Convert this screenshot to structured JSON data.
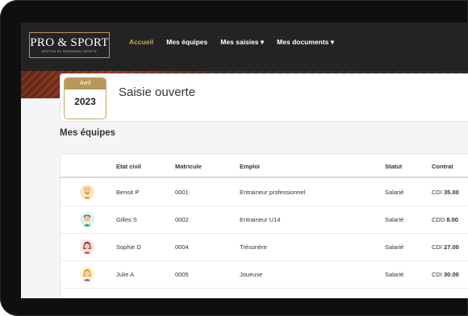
{
  "nav": {
    "logo_text": "PRO & SPORT",
    "logo_tagline": "GESTION DU PERSONNEL SPORTIF",
    "links": [
      {
        "label": "Accueil",
        "active": true
      },
      {
        "label": "Mes équipes",
        "active": false
      },
      {
        "label": "Mes saisies ▾",
        "active": false
      },
      {
        "label": "Mes documents ▾",
        "active": false
      }
    ]
  },
  "header": {
    "month": "Avril",
    "year": "2023",
    "status": "Saisie ouverte"
  },
  "section_title": "Mes équipes",
  "table": {
    "columns": [
      "Etat civil",
      "Matricule",
      "Emploi",
      "Statut",
      "Contrat"
    ],
    "rows": [
      {
        "avatar": "avatar-man-beard-icon",
        "etat_civil": "Benoit P",
        "matricule": "0001",
        "emploi": "Entraineur professionnel",
        "statut": "Salarié",
        "contrat_type": "CDI",
        "contrat_value": "35.00"
      },
      {
        "avatar": "avatar-man-icon",
        "etat_civil": "Gilles S",
        "matricule": "0002",
        "emploi": "Entraineur U14",
        "statut": "Salarié",
        "contrat_type": "CDD",
        "contrat_value": "8.00"
      },
      {
        "avatar": "avatar-woman-icon",
        "etat_civil": "Sophie D",
        "matricule": "0004",
        "emploi": "Trésorière",
        "statut": "Salarié",
        "contrat_type": "CDI",
        "contrat_value": "27.00"
      },
      {
        "avatar": "avatar-woman-blonde-icon",
        "etat_civil": "Julie A",
        "matricule": "0005",
        "emploi": "Joueuse",
        "statut": "Salarié",
        "contrat_type": "CDI",
        "contrat_value": "30.00"
      }
    ]
  },
  "colors": {
    "accent_gold": "#c9a660",
    "navbar": "#232323"
  }
}
